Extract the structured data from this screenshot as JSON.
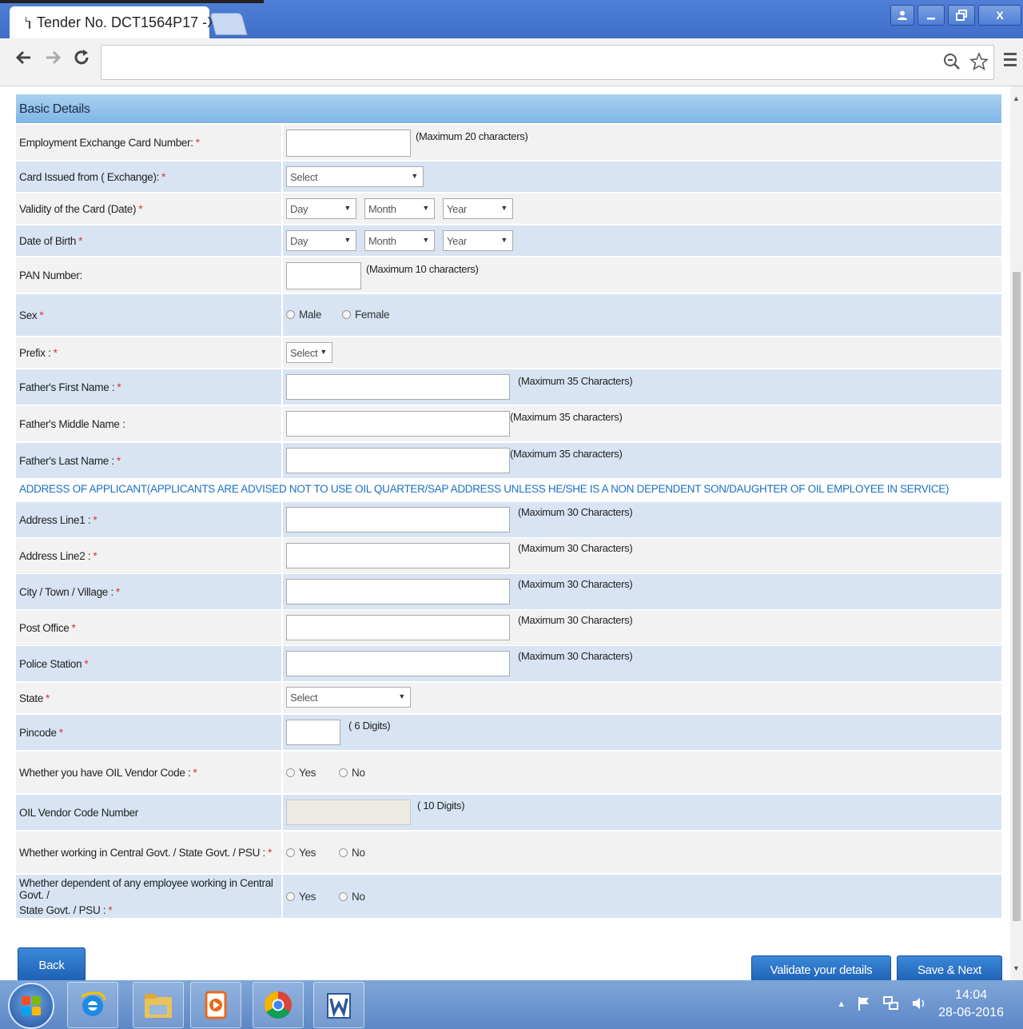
{
  "browser": {
    "tab_title": "Tender No. DCT1564P17 -",
    "tab_close": "X",
    "win_close": "X"
  },
  "form": {
    "section_title": "Basic Details",
    "address_note": "ADDRESS OF APPLICANT(APPLICANTS ARE ADVISED NOT TO USE OIL QUARTER/SAP ADDRESS UNLESS HE/SHE IS A NON DEPENDENT SON/DAUGHTER OF OIL EMPLOYEE IN SERVICE)",
    "required_mark": "*",
    "fields": {
      "emp_card": {
        "label": "Employment Exchange Card Number:",
        "hint": "(Maximum 20 characters)"
      },
      "card_issued": {
        "label": "Card Issued from ( Exchange):",
        "select": "Select"
      },
      "validity": {
        "label": "Validity of the Card (Date)",
        "day": "Day",
        "month": "Month",
        "year": "Year"
      },
      "dob": {
        "label": "Date of Birth",
        "day": "Day",
        "month": "Month",
        "year": "Year"
      },
      "pan": {
        "label": "PAN Number:",
        "hint": "(Maximum 10 characters)"
      },
      "sex": {
        "label": "Sex",
        "opt1": "Male",
        "opt2": "Female"
      },
      "prefix": {
        "label": "Prefix :",
        "select": "Select"
      },
      "father_first": {
        "label": "Father's First Name :",
        "hint": "(Maximum 35 Characters)"
      },
      "father_middle": {
        "label": "Father's Middle Name :",
        "hint": "(Maximum 35 characters)"
      },
      "father_last": {
        "label": "Father's Last Name :",
        "hint": "(Maximum 35 characters)"
      },
      "addr1": {
        "label": "Address Line1 :",
        "hint": "(Maximum 30 Characters)"
      },
      "addr2": {
        "label": "Address Line2 :",
        "hint": "(Maximum 30 Characters)"
      },
      "city": {
        "label": "City / Town / Village :",
        "hint": "(Maximum 30 Characters)"
      },
      "post": {
        "label": "Post Office",
        "hint": "(Maximum 30 Characters)"
      },
      "police": {
        "label": "Police Station",
        "hint": "(Maximum 30 Characters)"
      },
      "state": {
        "label": "State",
        "select": "Select"
      },
      "pincode": {
        "label": "Pincode",
        "hint": "( 6 Digits)"
      },
      "vendor_q": {
        "label": "Whether you have OIL Vendor Code :",
        "opt1": "Yes",
        "opt2": "No"
      },
      "vendor_no": {
        "label": "OIL Vendor Code Number",
        "hint": "( 10 Digits)"
      },
      "working": {
        "label": "Whether working in Central Govt. / State Govt. / PSU :",
        "opt1": "Yes",
        "opt2": "No"
      },
      "dependent": {
        "label_line1": "Whether dependent of any employee working in Central Govt. /",
        "label_line2": "State Govt. / PSU :",
        "opt1": "Yes",
        "opt2": "No"
      }
    },
    "buttons": {
      "back": "Back",
      "validate": "Validate your details",
      "save_next": "Save & Next"
    }
  },
  "taskbar": {
    "time": "14:04",
    "date": "28-06-2016"
  }
}
